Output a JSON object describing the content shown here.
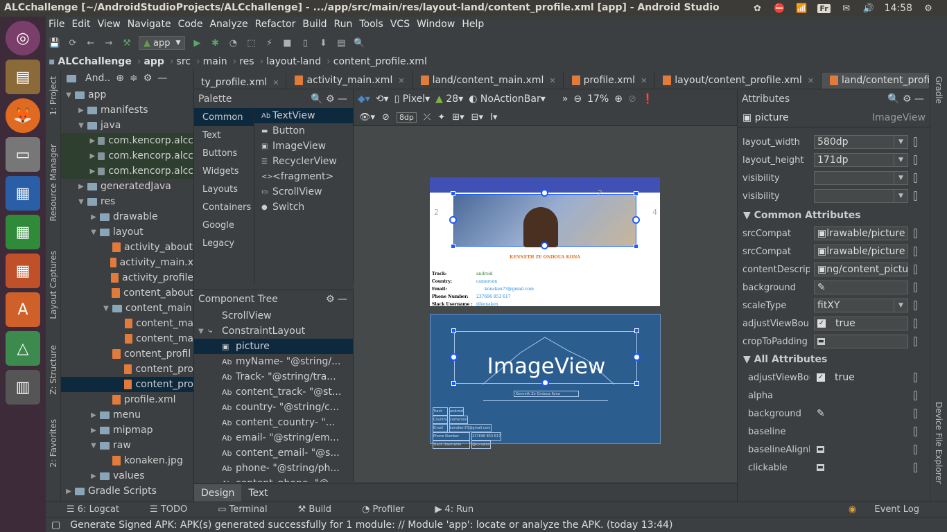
{
  "window_title": "ALCchallenge [~/AndroidStudioProjects/ALCchallenge] - .../app/src/main/res/layout-land/content_profile.xml [app] - Android Studio",
  "tray": {
    "lang": "Fr",
    "time": "14:58"
  },
  "menu": [
    "File",
    "Edit",
    "View",
    "Navigate",
    "Code",
    "Analyze",
    "Refactor",
    "Build",
    "Run",
    "Tools",
    "VCS",
    "Window",
    "Help"
  ],
  "toolbar": {
    "module": "app"
  },
  "breadcrumb": [
    "ALCchallenge",
    "app",
    "src",
    "main",
    "res",
    "layout-land",
    "content_profile.xml"
  ],
  "left_tools": [
    "1: Project",
    "Resource Manager",
    "Layout Captures",
    "Z: Structure",
    "2: Favorites"
  ],
  "project": {
    "header": "And..",
    "items": [
      {
        "label": "app",
        "depth": 0
      },
      {
        "label": "manifests",
        "depth": 1
      },
      {
        "label": "java",
        "depth": 1
      },
      {
        "label": "com.kencorp.alcc",
        "depth": 2
      },
      {
        "label": "com.kencorp.alcc",
        "depth": 2
      },
      {
        "label": "com.kencorp.alcc",
        "depth": 2
      },
      {
        "label": "generatedJava",
        "depth": 1
      },
      {
        "label": "res",
        "depth": 1
      },
      {
        "label": "drawable",
        "depth": 2
      },
      {
        "label": "layout",
        "depth": 2
      },
      {
        "label": "activity_about",
        "depth": 3
      },
      {
        "label": "activity_main.x",
        "depth": 3
      },
      {
        "label": "activity_profile",
        "depth": 3
      },
      {
        "label": "content_about",
        "depth": 3
      },
      {
        "label": "content_main",
        "depth": 3
      },
      {
        "label": "content_ma",
        "depth": 4
      },
      {
        "label": "content_ma",
        "depth": 4
      },
      {
        "label": "content_profil",
        "depth": 3
      },
      {
        "label": "content_pro",
        "depth": 4
      },
      {
        "label": "content_pro",
        "depth": 4
      },
      {
        "label": "profile.xml",
        "depth": 3
      },
      {
        "label": "menu",
        "depth": 2
      },
      {
        "label": "mipmap",
        "depth": 2
      },
      {
        "label": "raw",
        "depth": 2
      },
      {
        "label": "konaken.jpg",
        "depth": 3
      },
      {
        "label": "values",
        "depth": 2
      },
      {
        "label": "Gradle Scripts",
        "depth": 0
      }
    ]
  },
  "tabs": [
    {
      "label": "ty_profile.xml",
      "active": false
    },
    {
      "label": "activity_main.xml",
      "active": false
    },
    {
      "label": "land/content_main.xml",
      "active": false
    },
    {
      "label": "profile.xml",
      "active": false
    },
    {
      "label": "layout/content_profile.xml",
      "active": false
    },
    {
      "label": "land/content_profile.xml",
      "active": true
    }
  ],
  "palette": {
    "title": "Palette",
    "categories": [
      "Common",
      "Text",
      "Buttons",
      "Widgets",
      "Layouts",
      "Containers",
      "Google",
      "Legacy"
    ],
    "items": [
      {
        "glyph": "Ab",
        "label": "TextView"
      },
      {
        "glyph": "▬",
        "label": "Button"
      },
      {
        "glyph": "▣",
        "label": "ImageView"
      },
      {
        "glyph": "☰",
        "label": "RecyclerView"
      },
      {
        "glyph": "<>",
        "label": "<fragment>"
      },
      {
        "glyph": "▭",
        "label": "ScrollView"
      },
      {
        "glyph": "●",
        "label": "Switch"
      }
    ]
  },
  "component_tree": {
    "title": "Component Tree",
    "items": [
      {
        "glyph": "",
        "label": "ScrollView",
        "depth": 0
      },
      {
        "glyph": "⤷",
        "label": "ConstraintLayout",
        "depth": 0
      },
      {
        "glyph": "▣",
        "label": "picture",
        "depth": 1
      },
      {
        "glyph": "Ab",
        "label": "myName- \"@string/...",
        "depth": 1
      },
      {
        "glyph": "Ab",
        "label": "Track- \"@string/tra...",
        "depth": 1
      },
      {
        "glyph": "Ab",
        "label": "content_track- \"@st...",
        "depth": 1
      },
      {
        "glyph": "Ab",
        "label": "country- \"@string/c...",
        "depth": 1
      },
      {
        "glyph": "Ab",
        "label": "content_country- \"...",
        "depth": 1
      },
      {
        "glyph": "Ab",
        "label": "email- \"@string/em...",
        "depth": 1
      },
      {
        "glyph": "Ab",
        "label": "content_email- \"@s...",
        "depth": 1
      },
      {
        "glyph": "Ab",
        "label": "phone- \"@string/ph...",
        "depth": 1
      },
      {
        "glyph": "Ab",
        "label": "content_phone- \"@...",
        "depth": 1
      }
    ]
  },
  "design_toolbar": {
    "device": "Pixel",
    "api": "28",
    "theme": "NoActionBar",
    "zoom": "17%",
    "margin": "8dp"
  },
  "preview": {
    "name": "KENNETH ZE ONDOUA KONA",
    "rows": [
      {
        "label": "Track:",
        "value": "android"
      },
      {
        "label": "Country:",
        "value": "cameroon"
      },
      {
        "label": "Email:",
        "value": "konaken73@gmail.com"
      },
      {
        "label": "Phone Number:",
        "value": "237696 853 617"
      },
      {
        "label": "Slack Username :",
        "value": "@konaken"
      }
    ],
    "blueprint_label": "ImageView",
    "blueprint_name": "Kenneth Ze Ondoua Kona",
    "blueprint_rows": [
      {
        "label": "Track",
        "value": "android"
      },
      {
        "label": "Country",
        "value": "cameroon"
      },
      {
        "label": "Email",
        "value": "konaken73@gmail.com"
      },
      {
        "label": "Phone Number",
        "value": "237696 853 617"
      },
      {
        "label": "Slack Username",
        "value": "@konaken"
      }
    ],
    "margin_left": "2",
    "margin_right": "4",
    "margin_top": "2"
  },
  "bottom_tabs": [
    "Design",
    "Text"
  ],
  "attributes": {
    "title": "Attributes",
    "component": "picture",
    "component_type": "ImageView",
    "basic": [
      {
        "key": "layout_width",
        "value": "580dp",
        "dropdown": true
      },
      {
        "key": "layout_height",
        "value": "171dp",
        "dropdown": true
      },
      {
        "key": "visibility",
        "value": "",
        "dropdown": true
      },
      {
        "key": "visibility",
        "value": "",
        "dropdown": true
      }
    ],
    "common_title": "Common Attributes",
    "common": [
      {
        "key": "srcCompat",
        "value": "lrawable/picture"
      },
      {
        "key": "srcCompat",
        "value": "lrawable/picture"
      },
      {
        "key": "contentDescrip...",
        "value": "ng/content_picture"
      },
      {
        "key": "background",
        "value": ""
      },
      {
        "key": "scaleType",
        "value": "fitXY"
      },
      {
        "key": "adjustViewBou...",
        "value": "true"
      },
      {
        "key": "cropToPadding",
        "value": ""
      }
    ],
    "all_title": "All Attributes",
    "all": [
      {
        "key": "adjustViewBour",
        "value": "true"
      },
      {
        "key": "alpha",
        "value": ""
      },
      {
        "key": "background",
        "value": ""
      },
      {
        "key": "baseline",
        "value": ""
      },
      {
        "key": "baselineAlignBo",
        "value": ""
      },
      {
        "key": "clickable",
        "value": ""
      }
    ]
  },
  "right_tools": [
    "Gradle",
    "Device File Explorer"
  ],
  "bottom_bar": [
    "6: Logcat",
    "TODO",
    "Terminal",
    "Build",
    "Profiler",
    "4: Run",
    "Event Log"
  ],
  "status": "Generate Signed APK: APK(s) generated successfully for 1 module: // Module 'app': locate or analyze the APK. (today 13:44)"
}
